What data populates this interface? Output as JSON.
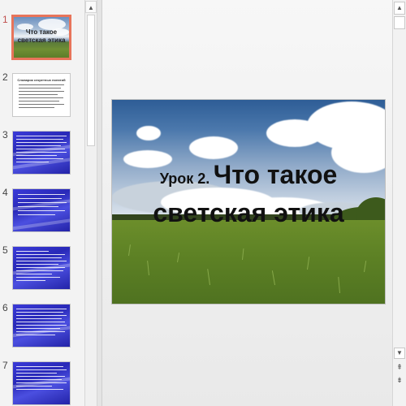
{
  "thumbnails": [
    {
      "number": "1",
      "line1": "Что такое",
      "line2": "светская этика"
    },
    {
      "number": "2",
      "title": "Словарик секретных понятий"
    },
    {
      "number": "3"
    },
    {
      "number": "4"
    },
    {
      "number": "5"
    },
    {
      "number": "6"
    },
    {
      "number": "7"
    }
  ],
  "main_slide": {
    "lesson_label": "Урок 2.",
    "title_line1": "Что такое",
    "title_line2": "светская этика"
  },
  "scrollbar": {
    "up_icon": "▲",
    "down_icon": "▼",
    "prev_slide_icon": "⇞",
    "next_slide_icon": "⇟"
  },
  "colors": {
    "selected_border": "#e8745a",
    "active_number": "#c0504d",
    "thumb_blue": "#2f2fc4"
  }
}
